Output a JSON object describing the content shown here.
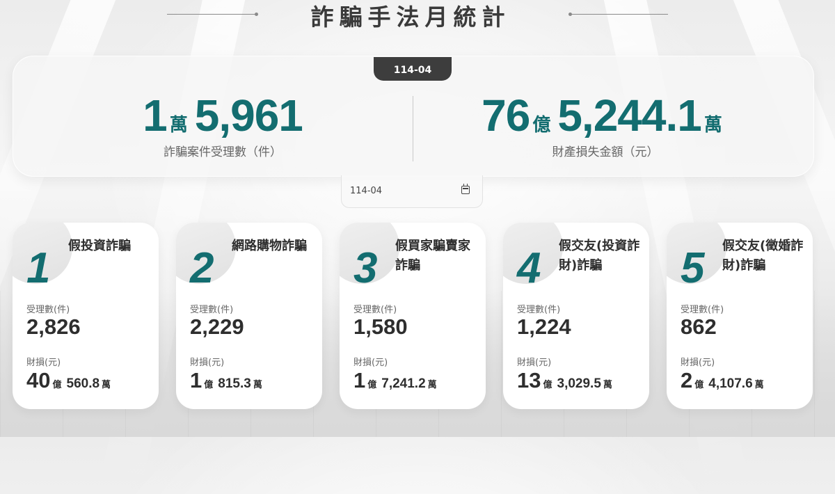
{
  "page": {
    "title": "詐騙手法月統計"
  },
  "summary": {
    "period": "114-04",
    "cases": {
      "wan": "1",
      "wan_unit": "萬",
      "rest": "5,961",
      "label": "詐騙案件受理數（件）"
    },
    "loss": {
      "yi": "76",
      "yi_unit": "億",
      "wan": "5,244.1",
      "wan_unit": "萬",
      "label": "財產損失金額（元）"
    }
  },
  "date_picker": {
    "value": "114-04",
    "icon": "calendar-icon"
  },
  "cards": [
    {
      "rank": "1",
      "name": "假投資詐騙",
      "count_label": "受理數(件)",
      "count": "2,826",
      "loss_label": "財損(元)",
      "loss_yi": "40",
      "yi_unit": "億",
      "loss_wan": "560.8",
      "wan_unit": "萬"
    },
    {
      "rank": "2",
      "name": "網路購物詐騙",
      "count_label": "受理數(件)",
      "count": "2,229",
      "loss_label": "財損(元)",
      "loss_yi": "1",
      "yi_unit": "億",
      "loss_wan": "815.3",
      "wan_unit": "萬"
    },
    {
      "rank": "3",
      "name": "假買家騙賣家詐騙",
      "count_label": "受理數(件)",
      "count": "1,580",
      "loss_label": "財損(元)",
      "loss_yi": "1",
      "yi_unit": "億",
      "loss_wan": "7,241.2",
      "wan_unit": "萬"
    },
    {
      "rank": "4",
      "name": "假交友(投資詐財)詐騙",
      "count_label": "受理數(件)",
      "count": "1,224",
      "loss_label": "財損(元)",
      "loss_yi": "13",
      "yi_unit": "億",
      "loss_wan": "3,029.5",
      "wan_unit": "萬"
    },
    {
      "rank": "5",
      "name": "假交友(徵婚詐財)詐騙",
      "count_label": "受理數(件)",
      "count": "862",
      "loss_label": "財損(元)",
      "loss_yi": "2",
      "yi_unit": "億",
      "loss_wan": "4,107.6",
      "wan_unit": "萬"
    }
  ]
}
